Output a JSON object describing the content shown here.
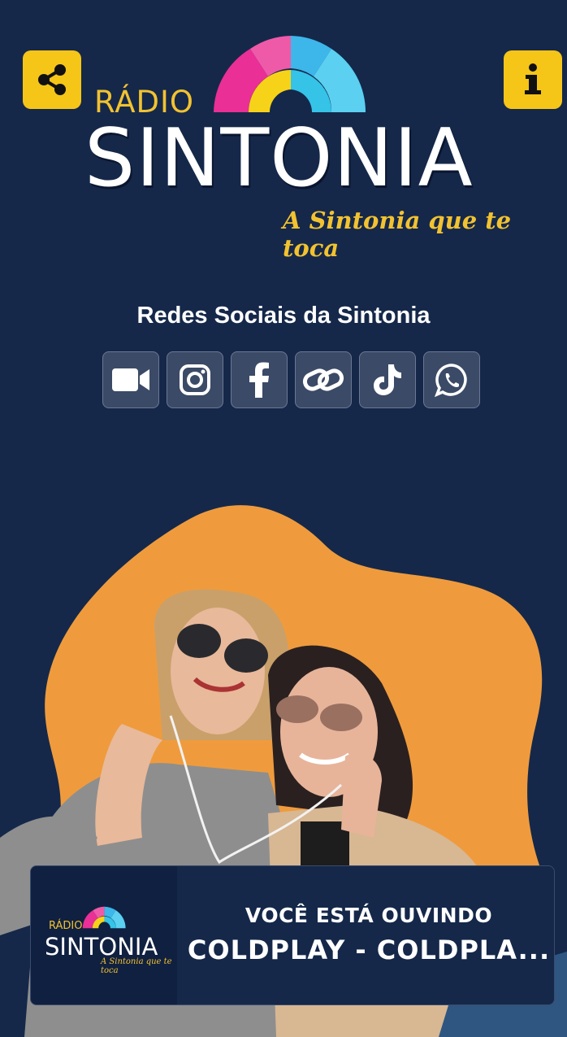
{
  "header": {
    "share_icon": "share-icon",
    "info_icon": "info-icon",
    "logo_radio": "RÁDIO",
    "logo_brand": "SINTONIA",
    "logo_slogan": "A Sintonia que te toca"
  },
  "social": {
    "title": "Redes Sociais da Sintonia",
    "icons": [
      "video-camera-icon",
      "instagram-icon",
      "facebook-icon",
      "link-icon",
      "tiktok-icon",
      "whatsapp-icon"
    ]
  },
  "player": {
    "logo_radio": "RÁDIO",
    "logo_brand": "SINTONIA",
    "logo_slogan": "A Sintonia que te toca",
    "now_playing_label": "VOCÊ ESTÁ OUVINDO",
    "track": "COLDPLAY - COLDPLA..."
  },
  "colors": {
    "background": "#15284a",
    "accent_yellow": "#f5c518",
    "blob_orange": "#ef9b3d",
    "social_button": "#3b4a66"
  }
}
